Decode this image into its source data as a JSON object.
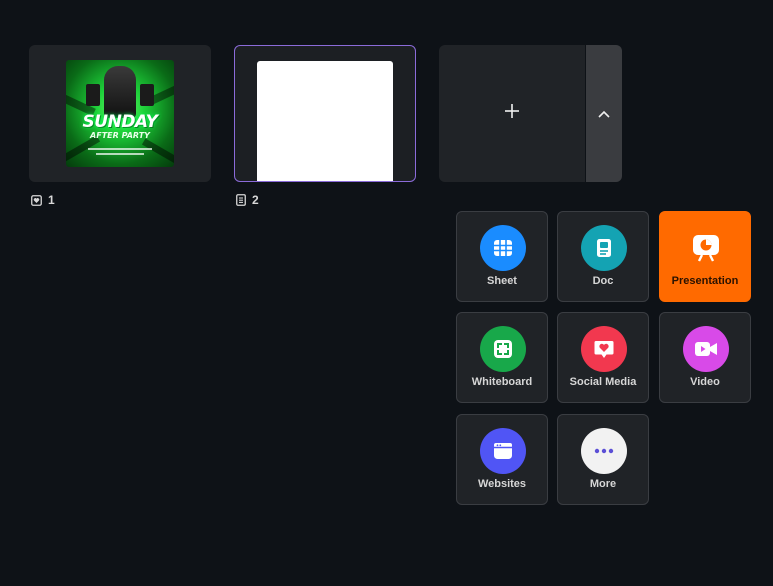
{
  "pages": [
    {
      "number": "1",
      "type_icon": "design-heart-icon",
      "thumbnail": {
        "title": "SUNDAY",
        "subtitle": "AFTER PARTY"
      }
    },
    {
      "number": "2",
      "type_icon": "document-icon",
      "selected": true
    }
  ],
  "add_page": {
    "icon": "plus-icon"
  },
  "expand": {
    "icon": "chevron-up-icon"
  },
  "create_menu": [
    {
      "label": "Sheet",
      "icon": "sheet-icon",
      "color": "#1a8cff"
    },
    {
      "label": "Doc",
      "icon": "doc-icon",
      "color": "#14a3b3"
    },
    {
      "label": "Presentation",
      "icon": "presentation-icon",
      "color": "#ff6a00",
      "active": true
    },
    {
      "label": "Whiteboard",
      "icon": "whiteboard-icon",
      "color": "#18a84a"
    },
    {
      "label": "Social Media",
      "icon": "social-media-icon",
      "color": "#f2384f"
    },
    {
      "label": "Video",
      "icon": "video-icon",
      "color": "#d84ae8"
    },
    {
      "label": "Websites",
      "icon": "websites-icon",
      "color": "#5055f5"
    },
    {
      "label": "More",
      "icon": "more-icon",
      "color": "#f2f2f2"
    }
  ]
}
